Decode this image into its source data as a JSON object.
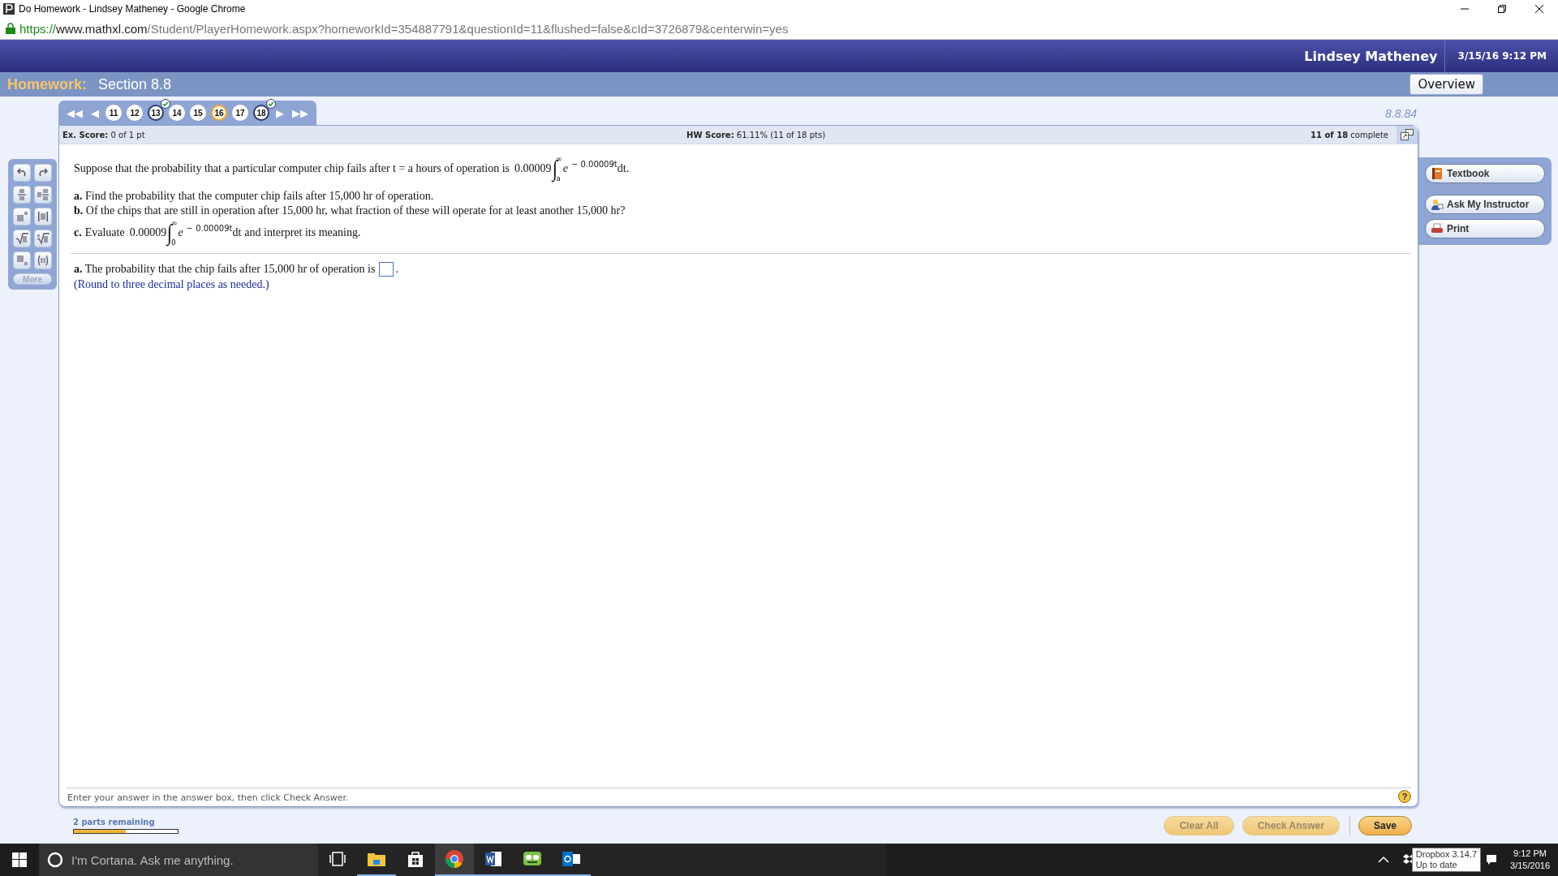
{
  "window": {
    "title": "Do Homework - Lindsey Matheney - Google Chrome"
  },
  "address_bar": {
    "scheme": "https://",
    "host": "www.mathxl.com",
    "path": "/Student/PlayerHomework.aspx?homeworkId=354887791&questionId=11&flushed=false&cId=3726879&centerwin=yes"
  },
  "header": {
    "user": "Lindsey Matheney",
    "datetime": "3/15/16 9:12 PM"
  },
  "homework_bar": {
    "label": "Homework:",
    "section": "Section 8.8",
    "overview_button": "Overview"
  },
  "question_nav": {
    "first": "◀◀",
    "prev": "◀",
    "next": "▶",
    "last": "▶▶",
    "questions": [
      {
        "number": "11",
        "answered": false,
        "current": false
      },
      {
        "number": "12",
        "answered": false,
        "current": false
      },
      {
        "number": "13",
        "answered": true,
        "current": false
      },
      {
        "number": "14",
        "answered": false,
        "current": false
      },
      {
        "number": "15",
        "answered": false,
        "current": false
      },
      {
        "number": "16",
        "answered": false,
        "current": true
      },
      {
        "number": "17",
        "answered": false,
        "current": false
      },
      {
        "number": "18",
        "answered": true,
        "current": false
      }
    ]
  },
  "question_id": "8.8.84",
  "score_strip": {
    "ex_label": "Ex. Score:",
    "ex_value": "0 of 1 pt",
    "hw_label": "HW Score:",
    "hw_value": "61.11% (11 of 18 pts)",
    "complete_count": "11 of 18",
    "complete_word": "complete"
  },
  "palette": {
    "more": "More"
  },
  "problem": {
    "intro": "Suppose that the probability that a particular computer chip fails after t = a hours of operation is",
    "integral": {
      "coefficient": "0.00009",
      "sign": "∫",
      "upper": "∞",
      "lower": "a",
      "base": "e",
      "exponent": "− 0.00009t",
      "tail": "dt."
    }
  },
  "parts": [
    {
      "kind": "text",
      "label": "a.",
      "text": "Find the probability that the computer chip fails after 15,000 hr of operation."
    },
    {
      "kind": "text",
      "label": "b.",
      "text": "Of the chips that are still in operation after 15,000 hr, what fraction of these will operate for at least another 15,000 hr?"
    },
    {
      "kind": "integral",
      "label": "c.",
      "prefix": "Evaluate",
      "integral": {
        "coefficient": "0.00009",
        "sign": "∫",
        "upper": "∞",
        "lower": "0",
        "base": "e",
        "exponent": "− 0.00009t",
        "tail": "dt"
      },
      "suffix": "and interpret its meaning."
    }
  ],
  "answer": {
    "label": "a.",
    "text": "The probability that the chip fails after 15,000 hr of operation is",
    "end": ".",
    "hint": "(Round to three decimal places as needed.)"
  },
  "instruction": "Enter your answer in the answer box, then click Check Answer.",
  "help": "?",
  "side_buttons": [
    {
      "kind": "book",
      "label": "Textbook"
    },
    {
      "kind": "instructor",
      "label": "Ask My Instructor"
    },
    {
      "kind": "printer",
      "label": "Print"
    }
  ],
  "progress": {
    "label": "2 parts remaining",
    "level": 0.5
  },
  "actions": [
    {
      "label": "Clear All",
      "disabled": true
    },
    {
      "label": "Check Answer",
      "disabled": true
    },
    {
      "label": "Save",
      "disabled": false
    }
  ],
  "taskbar": {
    "search": "I'm Cortana. Ask me anything.",
    "apps": [
      {
        "kind": "taskview",
        "running": false,
        "active": false
      },
      {
        "kind": "explorer",
        "running": true,
        "active": false
      },
      {
        "kind": "store",
        "running": false,
        "active": false
      },
      {
        "kind": "chrome",
        "running": true,
        "active": true
      },
      {
        "kind": "word",
        "running": true,
        "active": false
      },
      {
        "kind": "robot",
        "running": true,
        "active": false
      },
      {
        "kind": "outlook",
        "running": true,
        "active": false
      }
    ],
    "tooltip": [
      "Dropbox 3.14.7",
      "Up to date"
    ],
    "time": "9:12 PM",
    "date": "3/15/2016"
  }
}
